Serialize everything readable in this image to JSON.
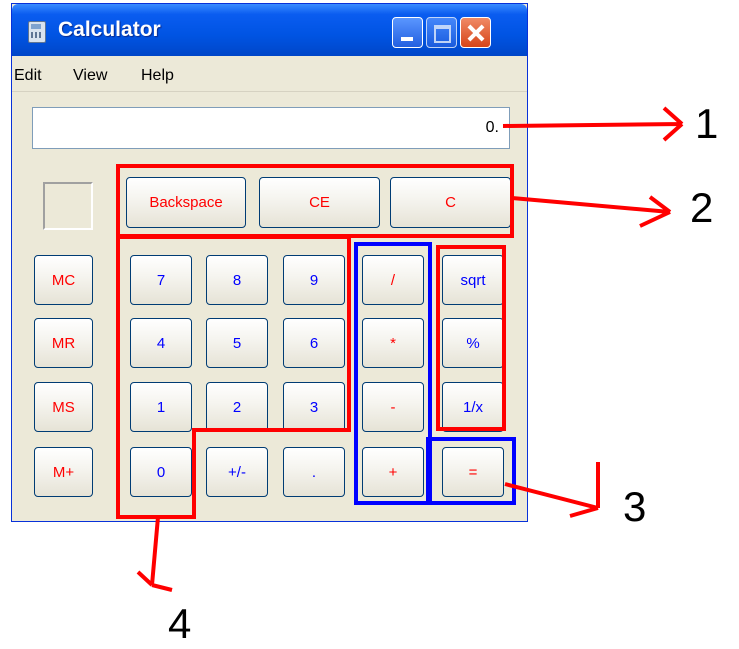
{
  "window": {
    "title": "Calculator"
  },
  "menu": [
    "Edit",
    "View",
    "Help"
  ],
  "display": {
    "value": "0."
  },
  "buttons": {
    "backspace": "Backspace",
    "ce": "CE",
    "c": "C",
    "mc": "MC",
    "mr": "MR",
    "ms": "MS",
    "mplus": "M+",
    "n7": "7",
    "n8": "8",
    "n9": "9",
    "n4": "4",
    "n5": "5",
    "n6": "6",
    "n1": "1",
    "n2": "2",
    "n3": "3",
    "n0": "0",
    "sign": "+/-",
    "dot": ".",
    "div": "/",
    "mul": "*",
    "sub": "-",
    "add": "+",
    "sqrt": "sqrt",
    "pct": "%",
    "inv": "1/x",
    "eq": "="
  },
  "annotations": [
    "1",
    "2",
    "3",
    "4"
  ],
  "colors": {
    "titlebar": "#0054e3",
    "annotation_red": "#ff0000",
    "annotation_blue": "#0000ff",
    "label_red": "#ff0000",
    "label_blue": "#0000ff"
  }
}
